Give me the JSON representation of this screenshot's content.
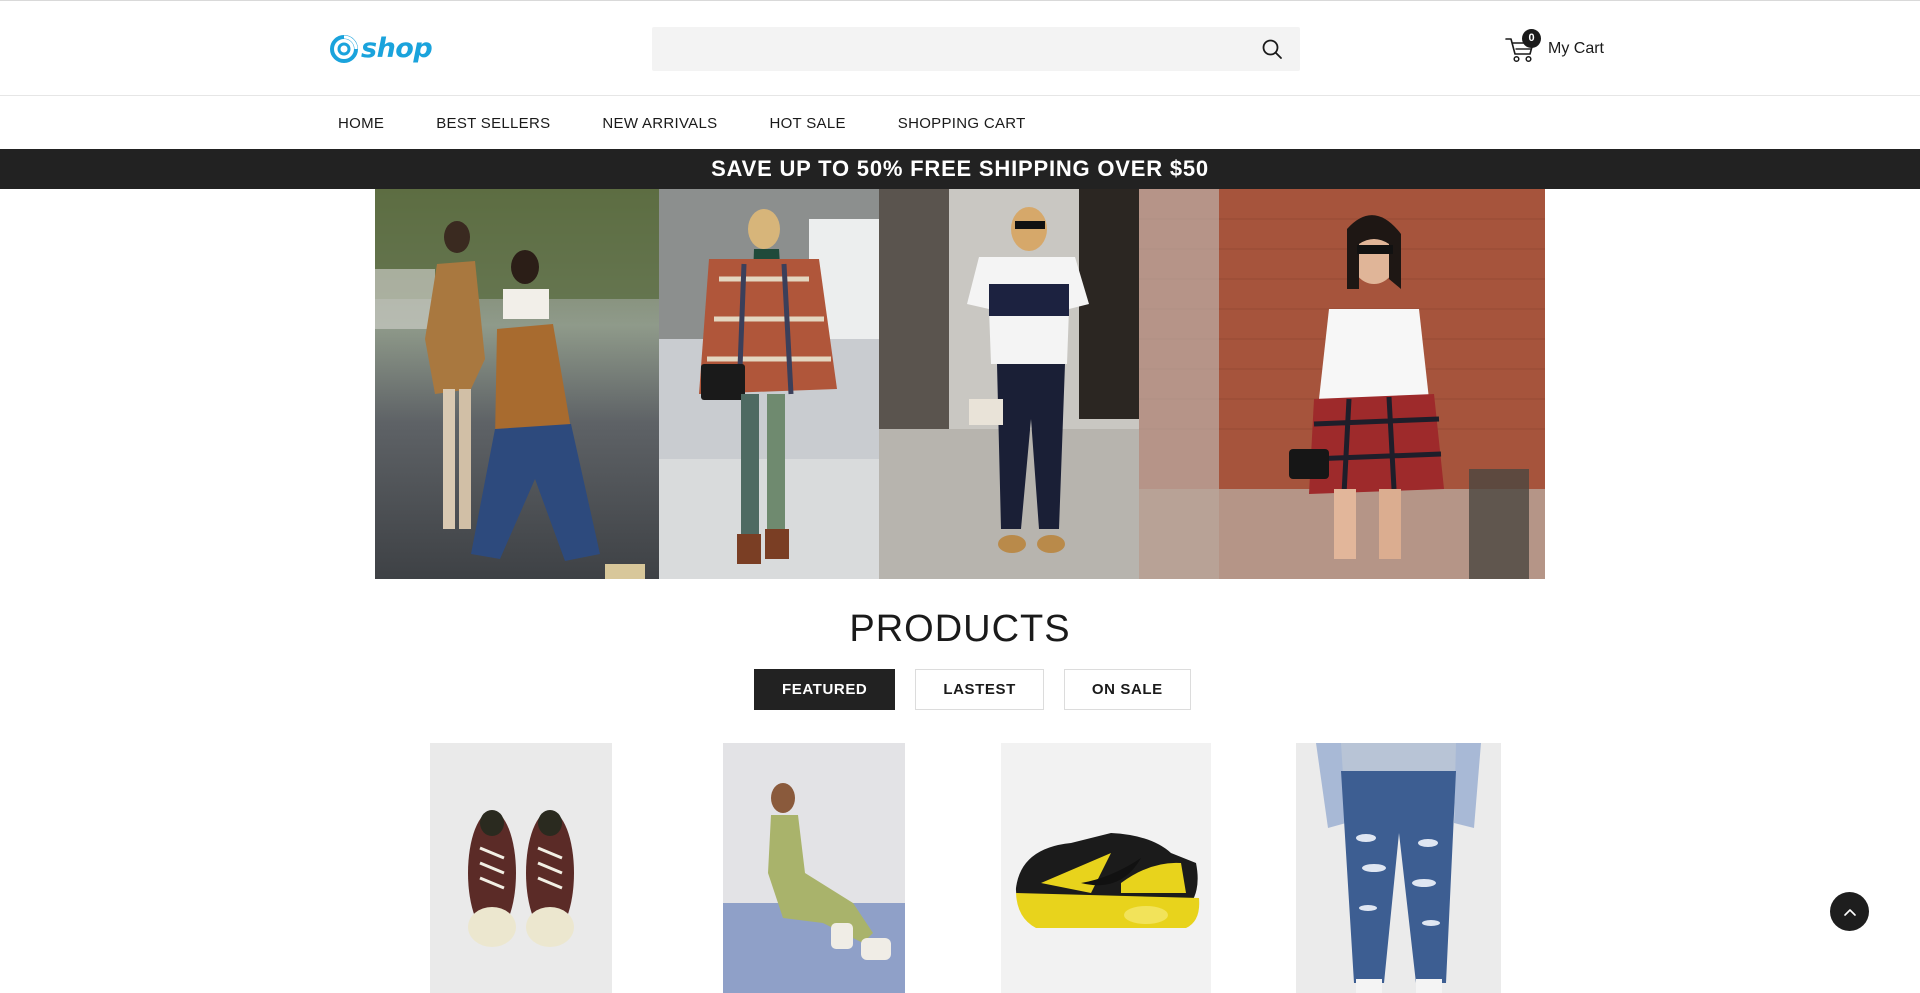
{
  "header": {
    "logo_text": "shop",
    "search": {
      "placeholder": "",
      "value": ""
    },
    "cart": {
      "count": "0",
      "label": "My Cart"
    }
  },
  "nav": {
    "items": [
      {
        "label": "HOME"
      },
      {
        "label": "BEST SELLERS"
      },
      {
        "label": "NEW ARRIVALS"
      },
      {
        "label": "HOT SALE"
      },
      {
        "label": "SHOPPING CART"
      }
    ]
  },
  "promo": {
    "text": "SAVE UP TO 50% FREE SHIPPING OVER $50"
  },
  "products": {
    "title": "PRODUCTS",
    "tabs": [
      {
        "label": "FEATURED",
        "active": true
      },
      {
        "label": "LASTEST",
        "active": false
      },
      {
        "label": "ON SALE",
        "active": false
      }
    ]
  },
  "colors": {
    "brand": "#1aa3dc",
    "dark": "#222222",
    "search_bg": "#f3f3f3"
  },
  "icons": [
    "logo-icon",
    "search-icon",
    "cart-icon",
    "chevron-up-icon"
  ]
}
